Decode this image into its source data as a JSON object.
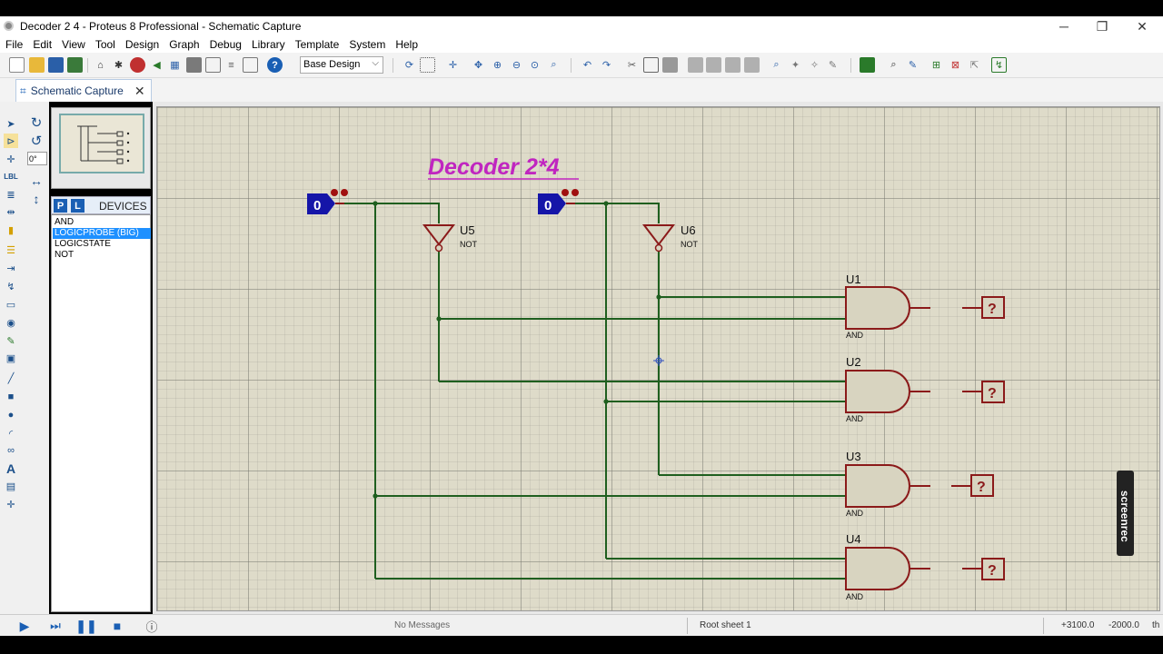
{
  "window": {
    "title": "Decoder 2 4 - Proteus 8 Professional - Schematic Capture",
    "minimize": "─",
    "restore": "❐",
    "close": "✕"
  },
  "menu": [
    "File",
    "Edit",
    "View",
    "Tool",
    "Design",
    "Graph",
    "Debug",
    "Library",
    "Template",
    "System",
    "Help"
  ],
  "toolbar": {
    "variant": "Base Design"
  },
  "tab": {
    "label": "Schematic Capture",
    "close": "✕"
  },
  "left_tools": {
    "rotation_value": "0°"
  },
  "devices": {
    "p_button": "P",
    "l_button": "L",
    "header": "DEVICES",
    "items": [
      "AND",
      "LOGICPROBE (BIG)",
      "LOGICSTATE",
      "NOT"
    ],
    "selected": "LOGICPROBE (BIG)"
  },
  "schematic": {
    "title": "Decoder 2*4",
    "logicstates": [
      "0",
      "0"
    ],
    "inverters": [
      {
        "ref": "U5",
        "type": "NOT"
      },
      {
        "ref": "U6",
        "type": "NOT"
      }
    ],
    "and_gates": [
      {
        "ref": "U1",
        "type": "AND"
      },
      {
        "ref": "U2",
        "type": "AND"
      },
      {
        "ref": "U3",
        "type": "AND"
      },
      {
        "ref": "U4",
        "type": "AND"
      }
    ],
    "probes": [
      "?",
      "?",
      "?",
      "?"
    ],
    "colors": {
      "wire": "#1f5f1f",
      "component": "#8b1a1a",
      "body": "#d8d4c0",
      "logicstate": "#1515a8",
      "title": "#c025c0"
    }
  },
  "status": {
    "messages": "No Messages",
    "sheet": "Root sheet 1",
    "x": "+3100.0",
    "y": "-2000.0",
    "unit": "th"
  },
  "watermark": "screenrec"
}
